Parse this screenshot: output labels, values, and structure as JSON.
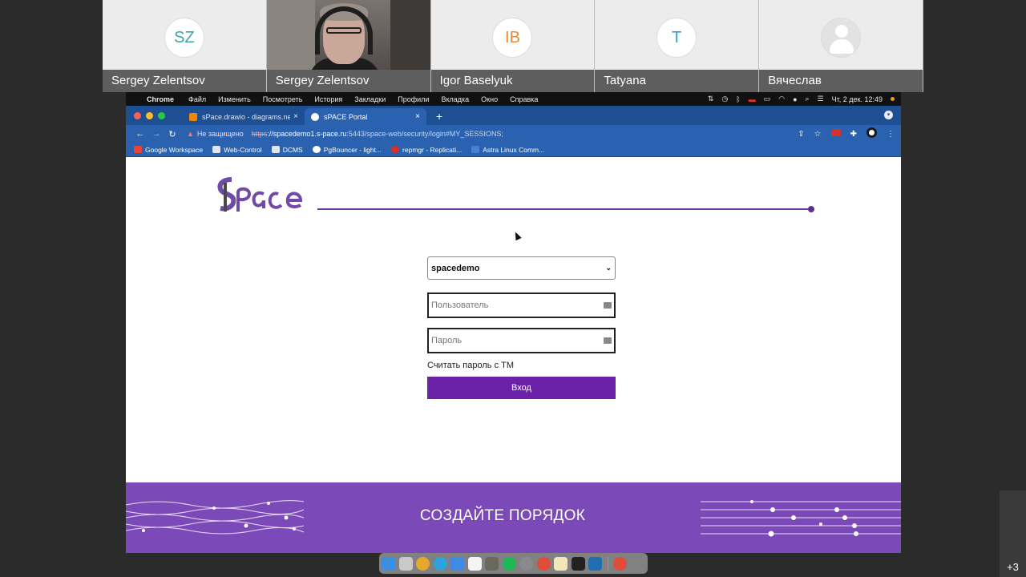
{
  "participants": [
    {
      "initials": "SZ",
      "name": "Sergey Zelentsov",
      "color": "#3aa5a5",
      "video": false
    },
    {
      "initials": "",
      "name": "Sergey Zelentsov",
      "color": "",
      "video": true
    },
    {
      "initials": "IB",
      "name": "Igor Baselyuk",
      "color": "#e8883a",
      "video": false
    },
    {
      "initials": "T",
      "name": "Tatyana",
      "color": "#2f9fd8",
      "video": false
    },
    {
      "initials": "",
      "name": "Вячеслав",
      "color": "#cfcfcf",
      "video": false
    }
  ],
  "menubar": {
    "app": "Chrome",
    "items": [
      "Файл",
      "Изменить",
      "Посмотреть",
      "История",
      "Закладки",
      "Профили",
      "Вкладка",
      "Окно",
      "Справка"
    ],
    "clock": "Чт, 2 дек.  12:49"
  },
  "tabs": [
    {
      "title": "sPace.drawio - diagrams.net",
      "close": "×",
      "active": false,
      "favicon_color": "#f08705"
    },
    {
      "title": "sPACE Portal",
      "close": "×",
      "active": true,
      "favicon_color": "#ffffff"
    }
  ],
  "new_tab": "+",
  "address_bar": {
    "warning": "Не защищено",
    "protocol": "https",
    "host": "://spacedemo1.s-pace.ru",
    "path": ":5443/space-web/security/login#MY_SESSIONS;"
  },
  "bookmarks": [
    {
      "label": "Google Workspace",
      "color": "#ea4335"
    },
    {
      "label": "Web-Control",
      "color": "#dfe6f3"
    },
    {
      "label": "DCMS",
      "color": "#dfe6f3"
    },
    {
      "label": "PgBouncer - light...",
      "color": "#ffffff"
    },
    {
      "label": "repmgr - Replicati...",
      "color": "#d93025"
    },
    {
      "label": "Astra Linux Comm...",
      "color": "#4a7fd4"
    }
  ],
  "login": {
    "domain_value": "spacedemo",
    "username_placeholder": "Пользователь",
    "password_placeholder": "Пароль",
    "tm_link": "Считать пароль с ТМ",
    "submit_label": "Вход"
  },
  "footer": {
    "slogan": "СОЗДАЙТЕ ПОРЯДОК"
  },
  "extra_participants": "+3",
  "colors": {
    "brand_purple": "#6b21a8",
    "footer_purple": "#7b4ab8",
    "chrome_blue": "#2a62b0"
  }
}
